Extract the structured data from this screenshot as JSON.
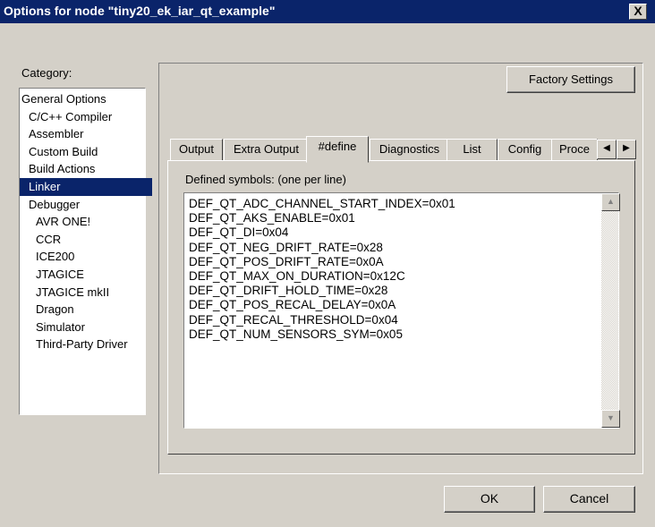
{
  "window": {
    "title": "Options for node \"tiny20_ek_iar_qt_example\"",
    "close_glyph": "X"
  },
  "category": {
    "label": "Category:",
    "items": [
      {
        "label": "General Options",
        "level": 0
      },
      {
        "label": "C/C++ Compiler",
        "level": 1
      },
      {
        "label": "Assembler",
        "level": 1
      },
      {
        "label": "Custom Build",
        "level": 1
      },
      {
        "label": "Build Actions",
        "level": 1
      },
      {
        "label": "Linker",
        "level": 1,
        "selected": true
      },
      {
        "label": "Debugger",
        "level": 1
      },
      {
        "label": "AVR ONE!",
        "level": 2
      },
      {
        "label": "CCR",
        "level": 2
      },
      {
        "label": "ICE200",
        "level": 2
      },
      {
        "label": "JTAGICE",
        "level": 2
      },
      {
        "label": "JTAGICE mkII",
        "level": 2
      },
      {
        "label": "Dragon",
        "level": 2
      },
      {
        "label": "Simulator",
        "level": 2
      },
      {
        "label": "Third-Party Driver",
        "level": 2
      }
    ]
  },
  "factory_settings_label": "Factory Settings",
  "tabs": [
    {
      "label": "Output"
    },
    {
      "label": "Extra Output"
    },
    {
      "label": "#define",
      "active": true
    },
    {
      "label": "Diagnostics"
    },
    {
      "label": "List"
    },
    {
      "label": "Config"
    },
    {
      "label": "Proce"
    }
  ],
  "define_page": {
    "label": "Defined symbols:  (one per line)",
    "symbols": [
      "DEF_QT_ADC_CHANNEL_START_INDEX=0x01",
      "DEF_QT_AKS_ENABLE=0x01",
      "DEF_QT_DI=0x04",
      "DEF_QT_NEG_DRIFT_RATE=0x28",
      "DEF_QT_POS_DRIFT_RATE=0x0A",
      "DEF_QT_MAX_ON_DURATION=0x12C",
      "DEF_QT_DRIFT_HOLD_TIME=0x28",
      "DEF_QT_POS_RECAL_DELAY=0x0A",
      "DEF_QT_RECAL_THRESHOLD=0x04",
      "DEF_QT_NUM_SENSORS_SYM=0x05"
    ]
  },
  "buttons": {
    "ok": "OK",
    "cancel": "Cancel"
  },
  "icons": [
    "close-icon",
    "arrow-left-icon",
    "arrow-right-icon",
    "arrow-up-icon",
    "arrow-down-icon"
  ],
  "colors": {
    "titlebar": "#0a246a",
    "face": "#d4d0c8",
    "selection": "#0a246a"
  }
}
